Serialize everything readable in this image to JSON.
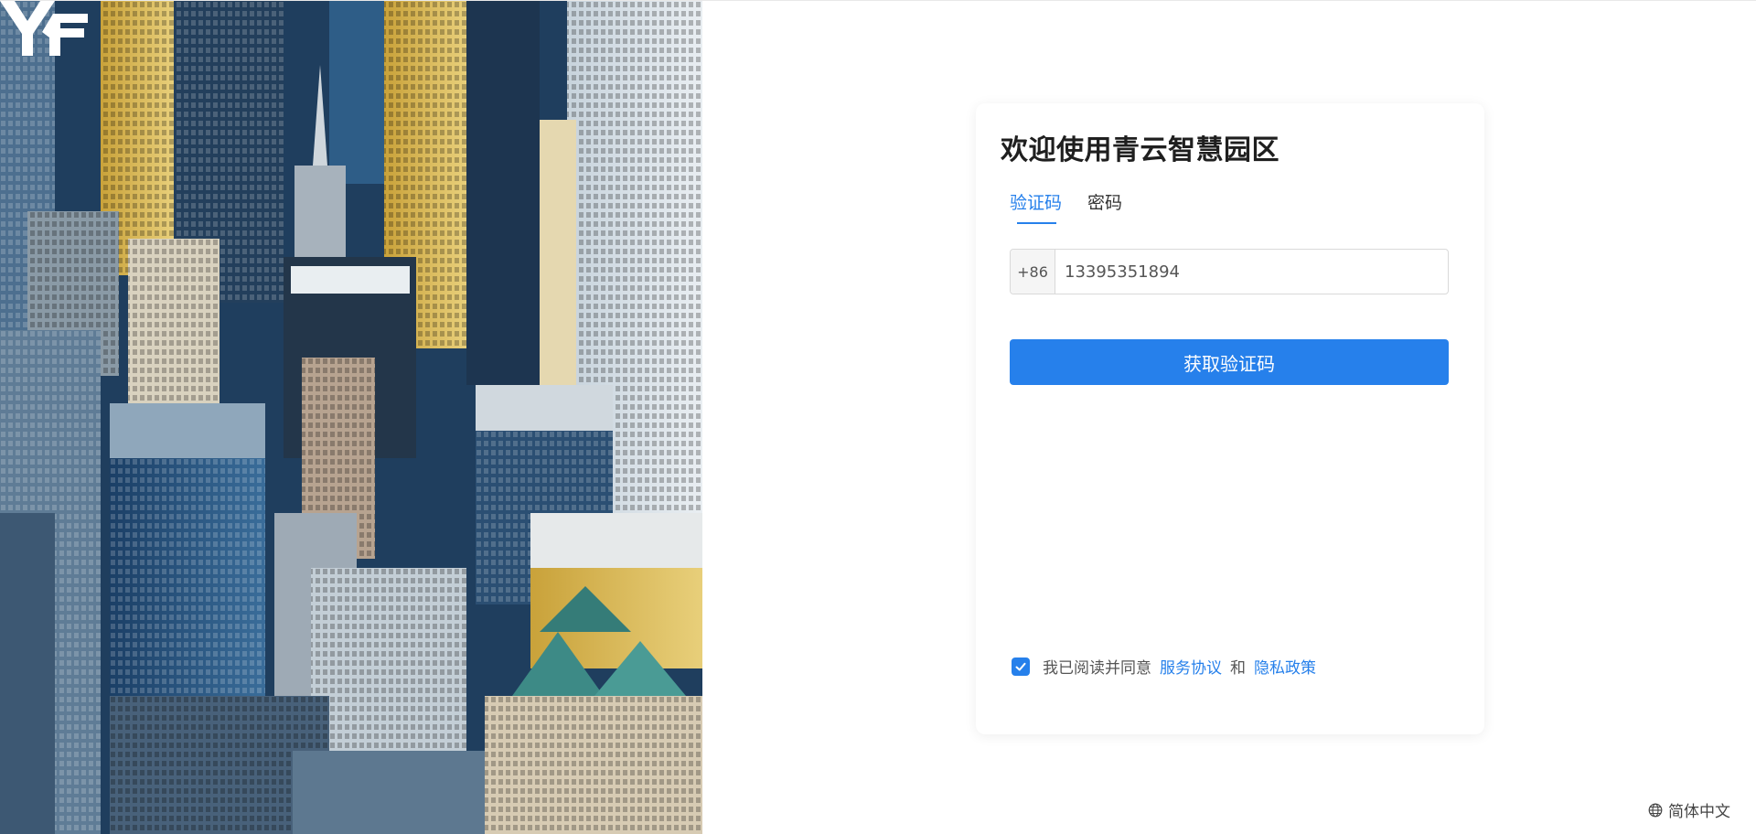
{
  "brand": {
    "logo_text": "YF"
  },
  "login": {
    "title": "欢迎使用青云智慧园区",
    "tabs": [
      {
        "label": "验证码",
        "active": true
      },
      {
        "label": "密码",
        "active": false
      }
    ],
    "phone_prefix": "+86",
    "phone_value": "13395351894",
    "submit_label": "获取验证码",
    "agreement": {
      "checked": true,
      "prefix": "我已阅读并同意",
      "service_link": "服务协议",
      "conjunction": "和",
      "privacy_link": "隐私政策"
    }
  },
  "language": {
    "label": "简体中文",
    "icon": "globe-icon"
  },
  "colors": {
    "primary": "#2680eb",
    "title": "#1f1f1f",
    "text": "#555555"
  }
}
